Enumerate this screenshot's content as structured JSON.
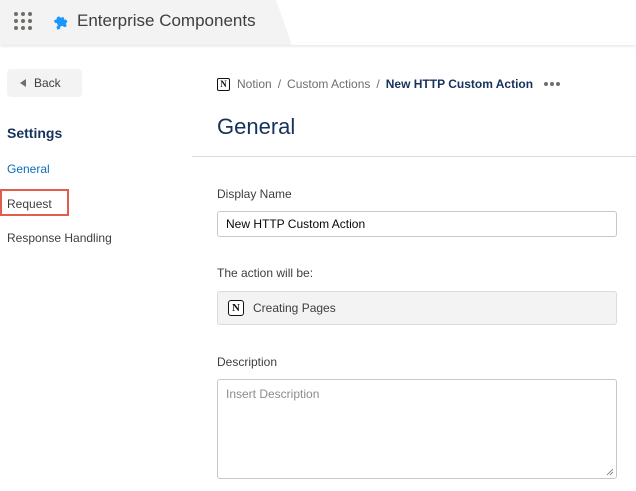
{
  "header": {
    "app_title": "Enterprise Components",
    "waffle_icon": "app-launcher-icon",
    "app_icon": "puzzle-piece-icon",
    "brand_color": "#1b96ff"
  },
  "sidebar": {
    "back_label": "Back",
    "settings_title": "Settings",
    "items": [
      {
        "label": "General",
        "active": true
      },
      {
        "label": "Request",
        "highlighted": true
      },
      {
        "label": "Response Handling"
      }
    ],
    "active_color": "#0b6fbf",
    "highlight_color": "#e35d4e"
  },
  "breadcrumb": {
    "items": [
      "Notion",
      "Custom Actions"
    ],
    "separator": "/",
    "current": "New HTTP Custom Action"
  },
  "main": {
    "page_title": "General",
    "display_name_label": "Display Name",
    "display_name_value": "New HTTP Custom Action",
    "action_label": "The action will be:",
    "action_value": "Creating Pages",
    "action_icon": "notion-icon",
    "description_label": "Description",
    "description_placeholder": "Insert Description"
  }
}
